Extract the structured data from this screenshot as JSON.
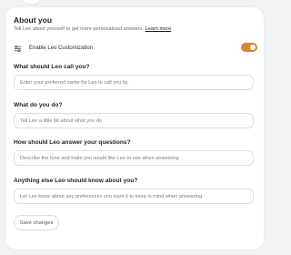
{
  "about": {
    "title": "About you",
    "subtitle": "Tell Leo about yourself to get more personalized answers.",
    "learn_more": "Learn more"
  },
  "customization": {
    "icon": "sliders-icon",
    "label": "Enable Leo Customization",
    "enabled": true,
    "accent": "#e0832b"
  },
  "fields": [
    {
      "question": "What should Leo call you?",
      "placeholder": "Enter your preferred name for Leo to call you by",
      "value": ""
    },
    {
      "question": "What do you do?",
      "placeholder": "Tell Leo a little bit about what you do",
      "value": ""
    },
    {
      "question": "How should Leo answer your questions?",
      "placeholder": "Describe the tone and traits you would like Leo to use when answering",
      "value": ""
    },
    {
      "question": "Anything else Leo should know about you?",
      "placeholder": "Let Leo know about any preferences you want it to keep in mind when answering",
      "value": ""
    }
  ],
  "save_label": "Save changes"
}
